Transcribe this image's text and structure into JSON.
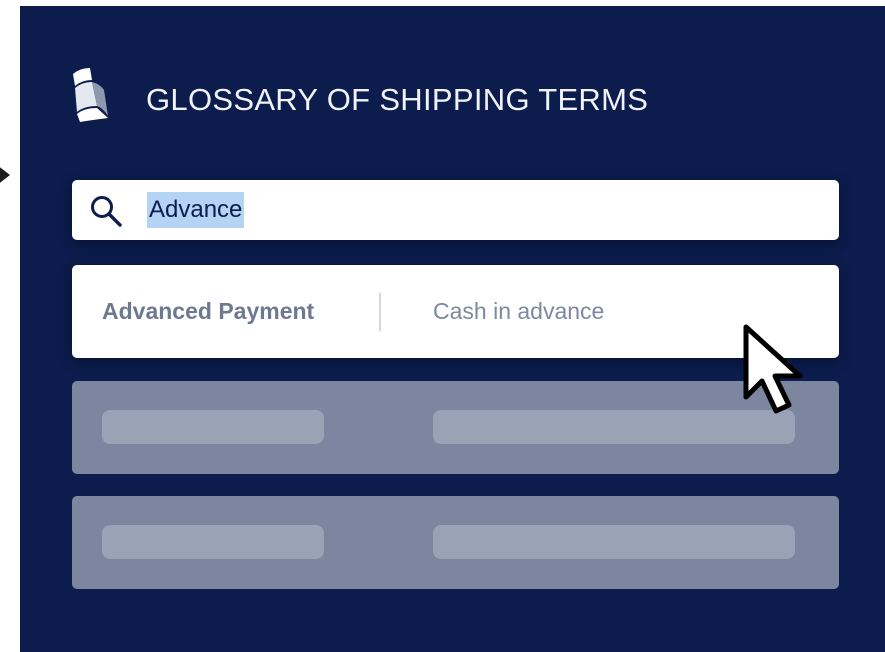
{
  "header": {
    "title": "GLOSSARY OF SHIPPING TERMS",
    "logo_icon": "folded-banner-logo-icon"
  },
  "search": {
    "icon": "search-icon",
    "value": "Advance",
    "selection": "Advance"
  },
  "results": [
    {
      "term": "Advanced Payment",
      "definition": "Cash in advance"
    }
  ],
  "placeholder_rows": 2,
  "cursor_icon": "pointer-cursor-icon",
  "colors": {
    "background": "#0b1c4d",
    "card": "#ffffff",
    "selection": "#b5d3f5",
    "term_text": "#6d7891",
    "definition_text": "#7e889e",
    "placeholder_row": "#7d869f",
    "placeholder_bar": "#9aa2b5"
  }
}
